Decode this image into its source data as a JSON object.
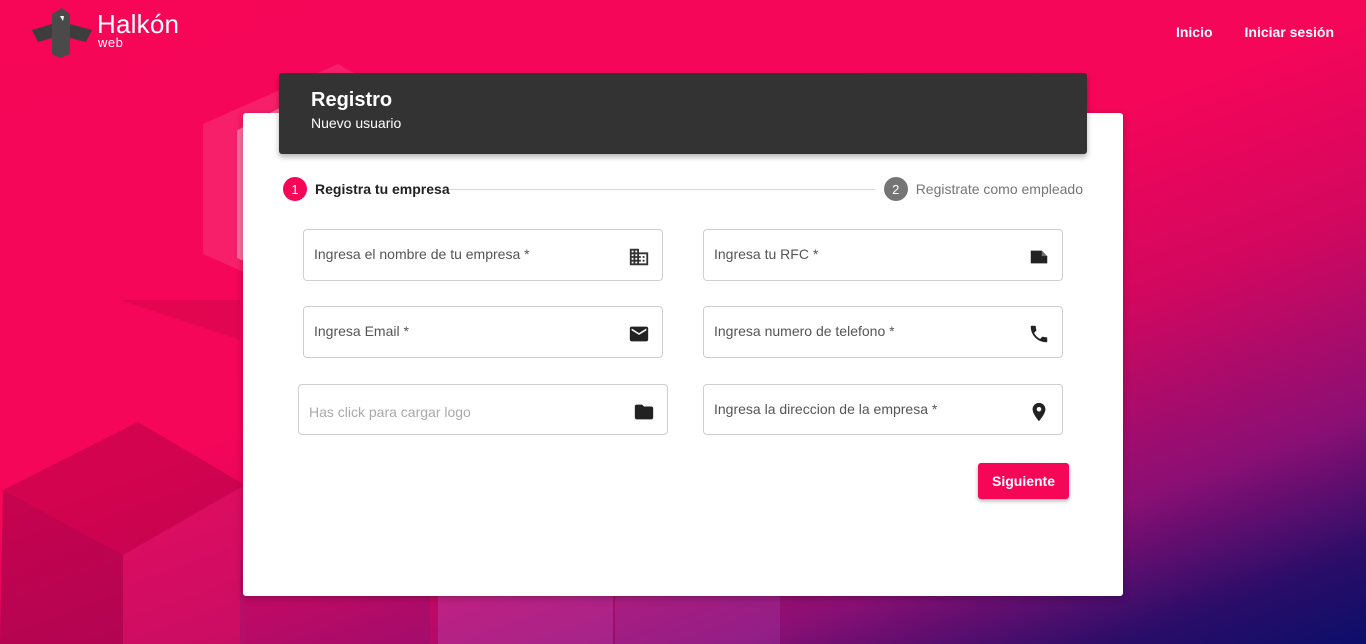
{
  "brand": {
    "name": "Halkón",
    "sub": "web"
  },
  "nav": {
    "home": "Inicio",
    "login": "Iniciar sesión"
  },
  "card": {
    "title": "Registro",
    "subtitle": "Nuevo usuario"
  },
  "stepper": {
    "steps": [
      {
        "number": "1",
        "label": "Registra tu empresa",
        "active": true
      },
      {
        "number": "2",
        "label": "Registrate como empleado",
        "active": false
      }
    ]
  },
  "form": {
    "company_name": {
      "placeholder": "Ingresa el nombre de tu empresa *",
      "icon": "business-icon"
    },
    "rfc": {
      "placeholder": "Ingresa tu RFC *",
      "icon": "badge-icon"
    },
    "email": {
      "placeholder": "Ingresa Email *",
      "icon": "mail-icon"
    },
    "phone": {
      "placeholder": "Ingresa numero de telefono *",
      "icon": "phone-icon"
    },
    "logo": {
      "placeholder": "Has click para cargar logo",
      "icon": "folder-icon"
    },
    "address": {
      "placeholder": "Ingresa la direccion de la empresa *",
      "icon": "location-pin-icon"
    },
    "next_button": "Siguiente"
  },
  "colors": {
    "accent": "#f50657",
    "header_dark": "#333333",
    "step_inactive": "#757575",
    "gradient_end": "#0b0e6a"
  }
}
